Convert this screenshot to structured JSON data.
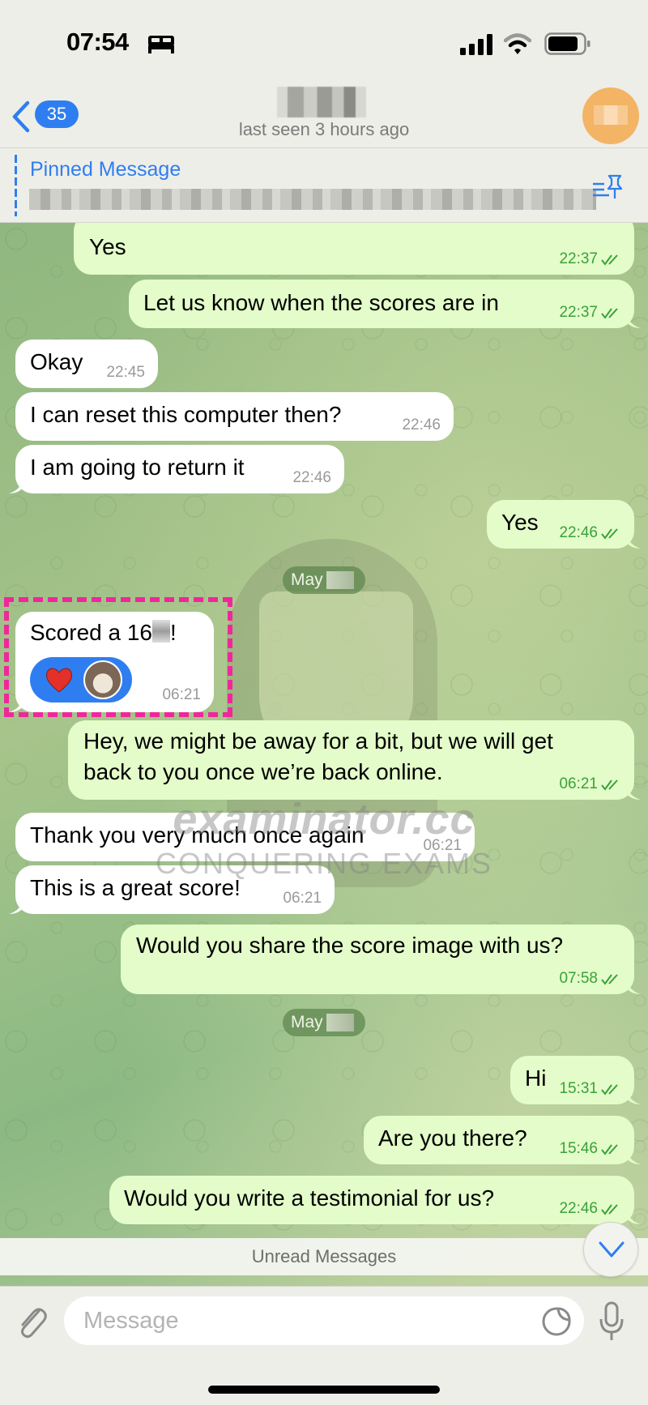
{
  "status_bar": {
    "time": "07:54",
    "focus_icon": "bed-icon",
    "signal_icon": "cellular-signal-icon",
    "wifi_icon": "wifi-icon",
    "battery_icon": "battery-icon"
  },
  "header": {
    "back_badge_count": "35",
    "contact_name": "[blurred]",
    "subtitle": "last seen 3 hours ago",
    "avatar_color": "#f3b466"
  },
  "pinned": {
    "title": "Pinned Message",
    "text": "[blurred]",
    "icon": "pin-list-icon"
  },
  "colors": {
    "accent": "#2f7ef1",
    "outgoing_bubble": "#e3fcc9",
    "incoming_bubble": "#ffffff",
    "outgoing_time": "#3aa13a",
    "highlight": "#f0279a"
  },
  "messages": [
    {
      "dir": "out",
      "text": "Yes",
      "time": "22:37",
      "read": true
    },
    {
      "dir": "out",
      "text": "Let us know when the scores are in",
      "time": "22:37",
      "read": true
    },
    {
      "dir": "in",
      "text": "Okay",
      "time": "22:45"
    },
    {
      "dir": "in",
      "text": "I can reset this computer then?",
      "time": "22:46"
    },
    {
      "dir": "in",
      "text": "I am going to return it",
      "time": "22:46"
    },
    {
      "dir": "out",
      "text": "Yes",
      "time": "22:46",
      "read": true
    },
    {
      "dir": "in",
      "text_prefix": "Scored a 16",
      "text_suffix": "!",
      "time": "06:21",
      "reactions": [
        "heart"
      ]
    },
    {
      "dir": "out",
      "text_line1": "Hey, we might be away for a bit, but we will get",
      "text_line2": "back to you once we’re back online.",
      "time": "06:21",
      "read": true
    },
    {
      "dir": "in",
      "text": "Thank you very much once again",
      "time": "06:21"
    },
    {
      "dir": "in",
      "text": "This is a great score!",
      "time": "06:21"
    },
    {
      "dir": "out",
      "text": "Would you share the score image with us?",
      "time": "07:58",
      "read": true
    },
    {
      "dir": "out",
      "text": "Hi",
      "time": "15:31",
      "read": true
    },
    {
      "dir": "out",
      "text": "Are you there?",
      "time": "15:46",
      "read": true
    },
    {
      "dir": "out",
      "text": "Would you write a testimonial for us?",
      "time": "22:46",
      "read": true
    }
  ],
  "date_separators": [
    "May",
    "May"
  ],
  "watermark": {
    "line1": "examinator.cc",
    "line2": "CONQUERING EXAMS"
  },
  "unread_label": "Unread Messages",
  "input": {
    "placeholder": "Message",
    "value": ""
  }
}
